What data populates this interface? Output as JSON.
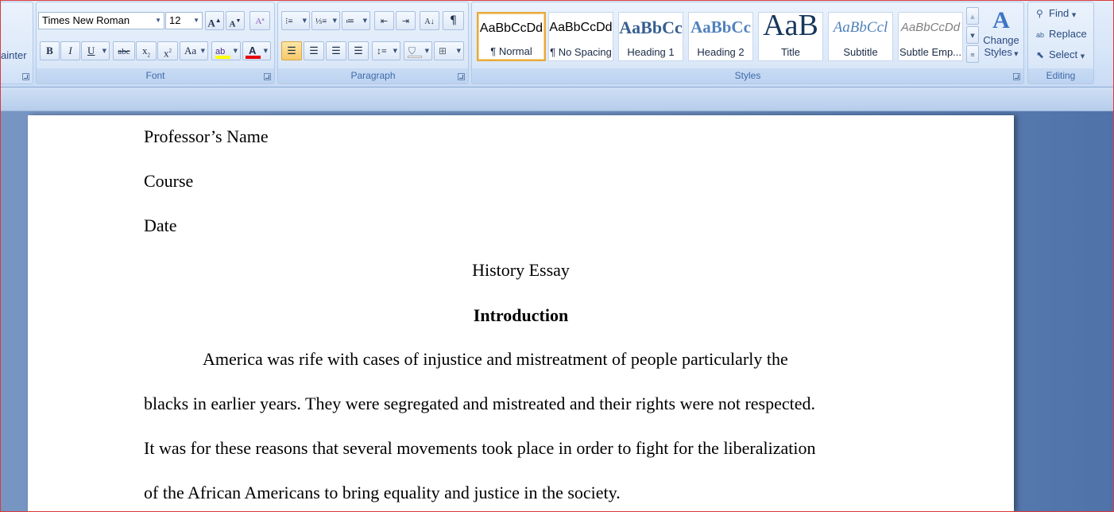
{
  "clipboard": {
    "format_painter_partial": "ainter"
  },
  "font": {
    "group_label": "Font",
    "font_name": "Times New Roman",
    "font_size": "12",
    "grow_label": "A",
    "shrink_label": "A",
    "bold_label": "B",
    "italic_label": "I",
    "underline_label": "U",
    "strike_label": "abc",
    "subscript_label": "x",
    "superscript_label": "x",
    "case_label": "Aa",
    "highlight_label": "ab",
    "font_color_label": "A",
    "highlight_color": "#ffff00",
    "font_color": "#e60000"
  },
  "paragraph": {
    "group_label": "Paragraph",
    "show_marks_label": "¶"
  },
  "styles": {
    "group_label": "Styles",
    "tiles": [
      {
        "preview": "AaBbCcDd",
        "name": "¶ Normal"
      },
      {
        "preview": "AaBbCcDd",
        "name": "¶ No Spacing"
      },
      {
        "preview": "AaBbCc",
        "name": "Heading 1"
      },
      {
        "preview": "AaBbCc",
        "name": "Heading 2"
      },
      {
        "preview": "AaB",
        "name": "Title"
      },
      {
        "preview": "AaBbCcl",
        "name": "Subtitle"
      },
      {
        "preview": "AaBbCcDd",
        "name": "Subtle Emp..."
      }
    ],
    "change_styles_line1": "Change",
    "change_styles_line2": "Styles"
  },
  "editing": {
    "group_label": "Editing",
    "find_label": "Find",
    "replace_label": "Replace",
    "select_label": "Select"
  },
  "document": {
    "lines": [
      "Professor’s Name",
      "Course",
      "Date",
      "History Essay",
      "Introduction",
      "America was rife with cases of injustice and mistreatment of people particularly the",
      "blacks in earlier years. They were segregated and mistreated and their rights were not respected.",
      "It was for these reasons that several movements took place in order to fight for the liberalization",
      "of the African Americans to bring equality and justice in the society."
    ]
  }
}
